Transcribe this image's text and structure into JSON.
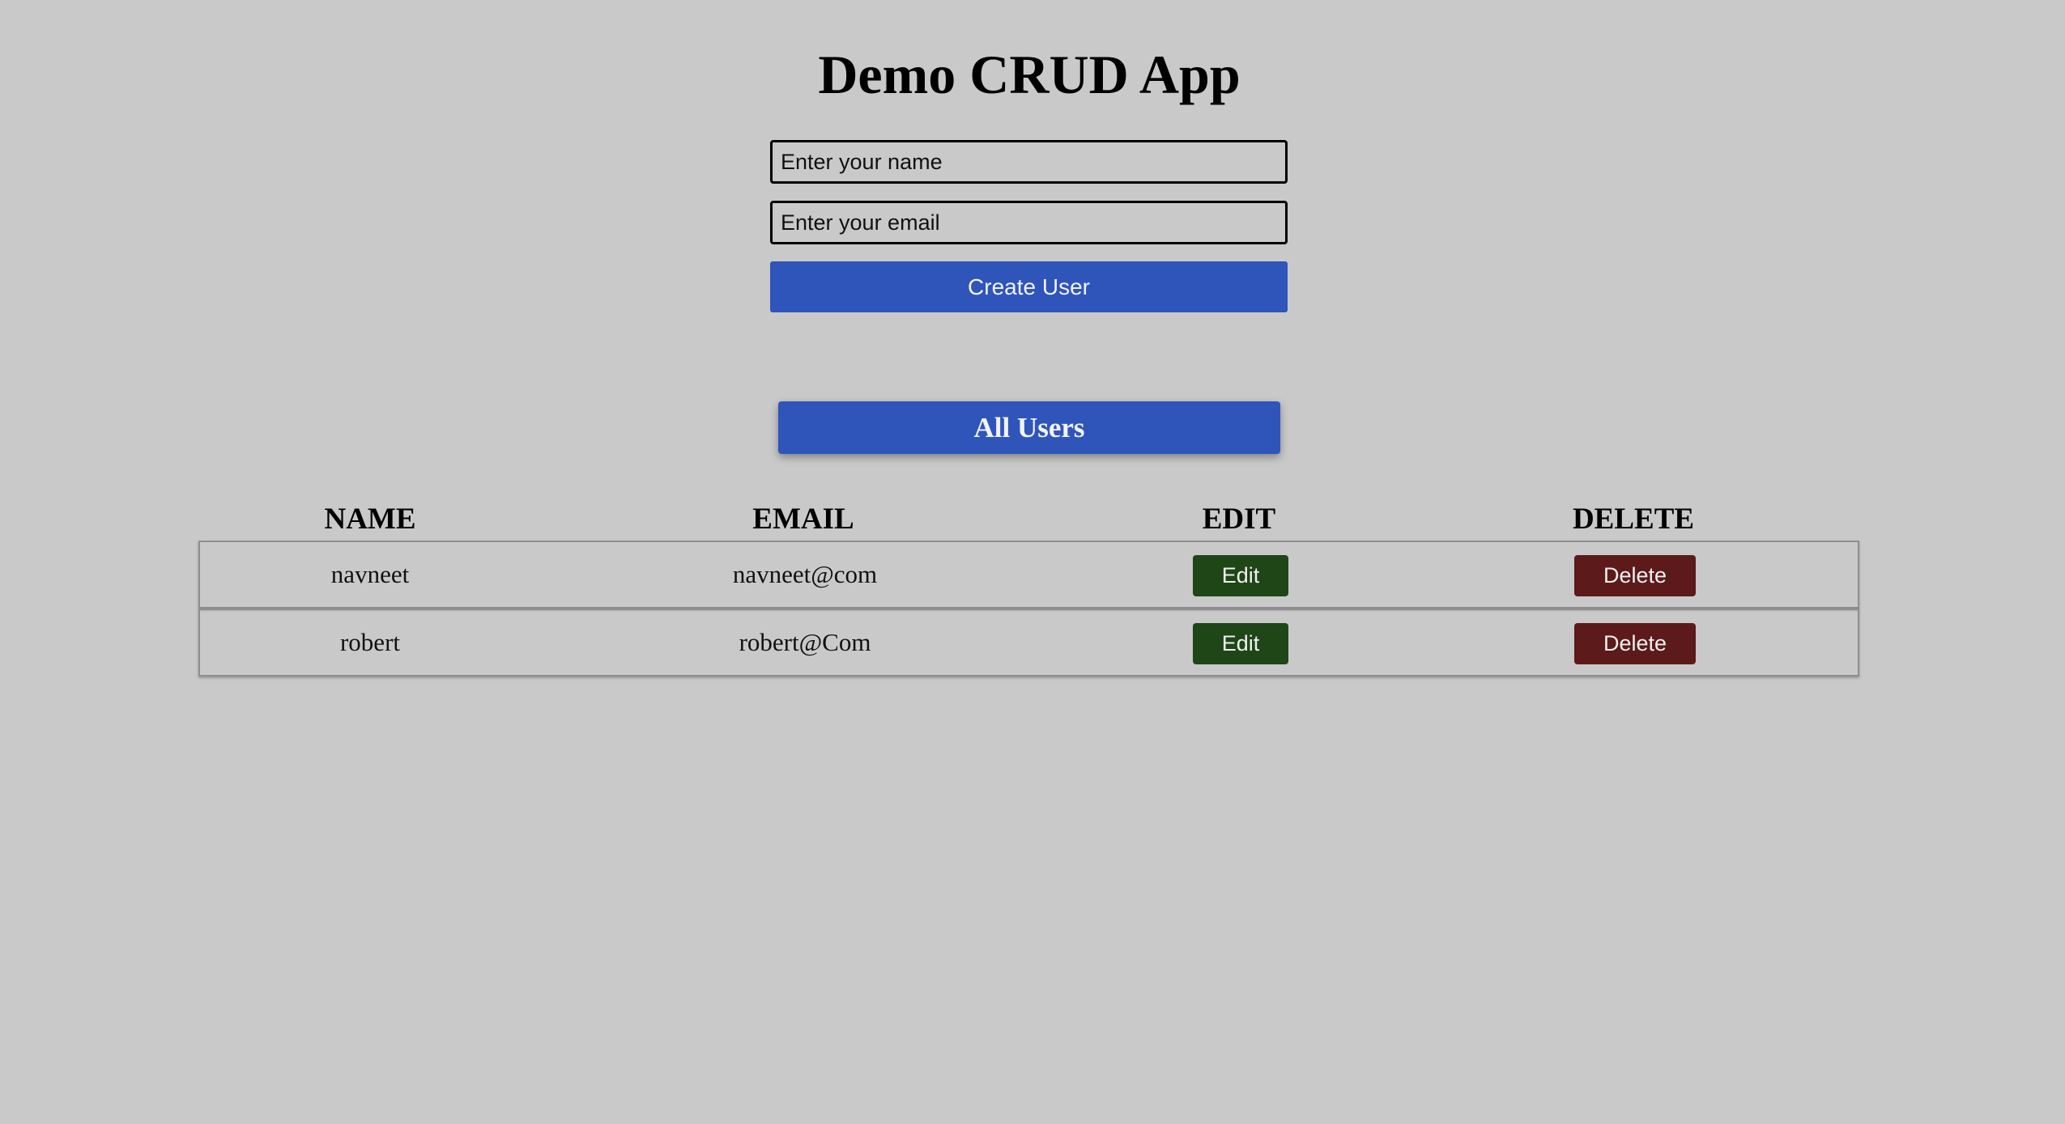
{
  "app": {
    "title": "Demo CRUD App"
  },
  "form": {
    "name_placeholder": "Enter your name",
    "name_value": "",
    "email_placeholder": "Enter your email",
    "email_value": "",
    "create_label": "Create User"
  },
  "users_section": {
    "title": "All Users"
  },
  "table": {
    "headers": {
      "name": "NAME",
      "email": "EMAIL",
      "edit": "EDIT",
      "delete": "DELETE"
    },
    "rows": [
      {
        "name": "navneet",
        "email": "navneet@com",
        "edit_label": "Edit",
        "delete_label": "Delete"
      },
      {
        "name": "robert",
        "email": "robert@Com",
        "edit_label": "Edit",
        "delete_label": "Delete"
      }
    ]
  },
  "colors": {
    "background": "#c9c9c9",
    "primary": "#2f55bb",
    "edit": "#1e4616",
    "delete": "#5c1a1a"
  }
}
